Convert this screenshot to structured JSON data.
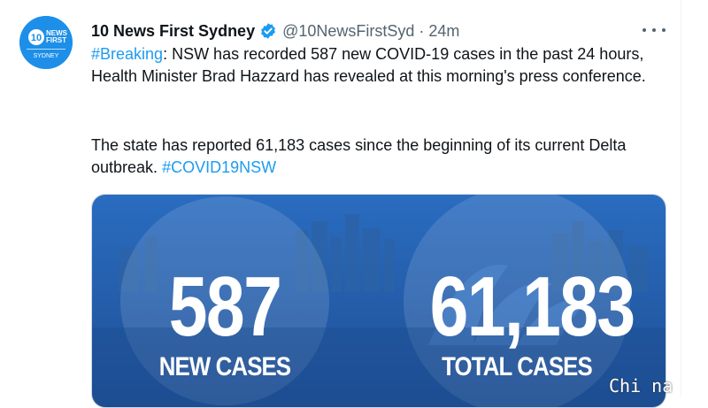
{
  "tweet": {
    "display_name": "10 News First Sydney",
    "handle": "@10NewsFirstSyd",
    "separator": "·",
    "time": "24m",
    "avatar_text": [
      "10",
      "NEWS",
      "FIRST",
      "SYDNEY"
    ],
    "paragraph1": {
      "hashtag": "#Breaking",
      "text": ": NSW has recorded 587 new COVID-19 cases in the past 24 hours, Health Minister Brad Hazzard has revealed at this morning's press conference."
    },
    "paragraph2": {
      "text": "The state has reported 61,183 cases since the beginning of its current Delta outbreak. ",
      "hashtag": "#COVID19NSW"
    },
    "media": {
      "stat1_value": "587",
      "stat1_label": "NEW CASES",
      "stat2_value": "61,183",
      "stat2_label": "TOTAL CASES"
    }
  },
  "watermark": "Chi na",
  "colors": {
    "link": "#1d9bf0",
    "text": "#0f1419",
    "secondary": "#536471",
    "media_blue": "#2f6fbf"
  },
  "icons": [
    "verified-badge-icon",
    "more-options-icon"
  ]
}
